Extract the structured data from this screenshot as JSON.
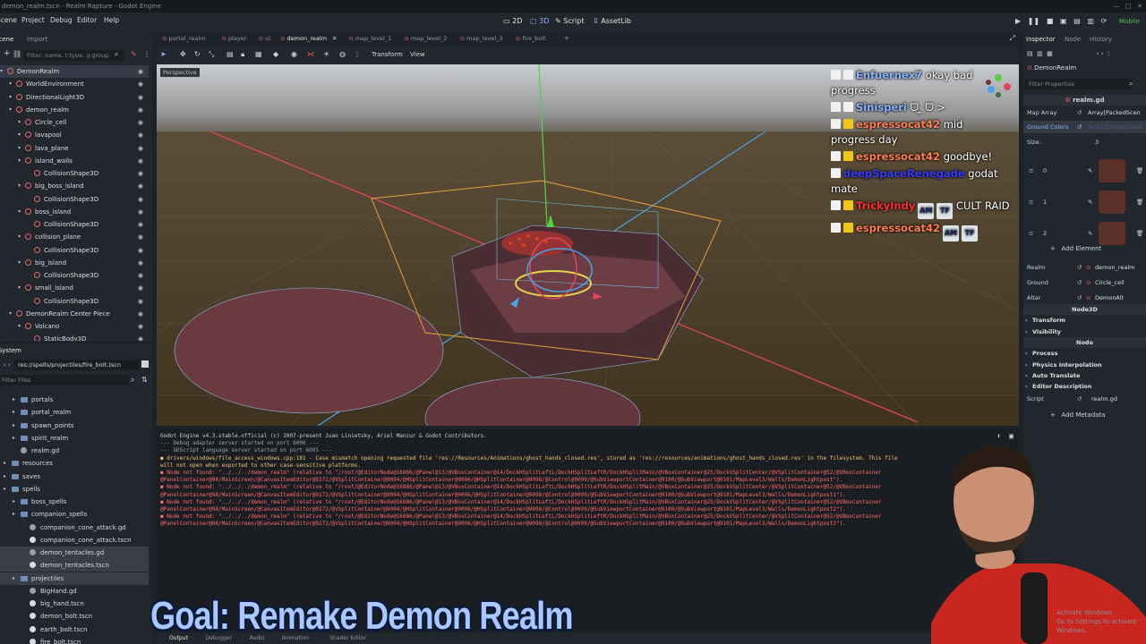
{
  "window": {
    "title": "demon_realm.tscn - Realm Rapture - Godot Engine",
    "controls": [
      "−",
      "□",
      "✕"
    ]
  },
  "menubar": {
    "menus": [
      "Scene",
      "Project",
      "Debug",
      "Editor",
      "Help"
    ],
    "workspaces": [
      {
        "label": "2D",
        "active": false
      },
      {
        "label": "3D",
        "active": true
      },
      {
        "label": "Script",
        "active": false
      },
      {
        "label": "AssetLib",
        "active": false
      }
    ],
    "renderer": "Mobile"
  },
  "scene_dock": {
    "tabs": [
      "Scene",
      "Import"
    ],
    "filter_placeholder": "Filter: name, t:type, g:group",
    "nodes": [
      {
        "label": "DemonRealm",
        "depth": 0,
        "icon": "node3d-icon",
        "selected": true
      },
      {
        "label": "WorldEnvironment",
        "depth": 1,
        "icon": "world-icon"
      },
      {
        "label": "DirectionalLight3D",
        "depth": 1,
        "icon": "light-icon"
      },
      {
        "label": "demon_realm",
        "depth": 1,
        "icon": "node3d-icon"
      },
      {
        "label": "Circle_cell",
        "depth": 2,
        "icon": "mesh-icon"
      },
      {
        "label": "lavapool",
        "depth": 2,
        "icon": "mesh-icon"
      },
      {
        "label": "lava_plane",
        "depth": 2,
        "icon": "mesh-icon"
      },
      {
        "label": "island_walls",
        "depth": 2,
        "icon": "mesh-icon"
      },
      {
        "label": "CollisionShape3D",
        "depth": 3,
        "icon": "collision-icon"
      },
      {
        "label": "big_boss_island",
        "depth": 2,
        "icon": "mesh-icon"
      },
      {
        "label": "CollisionShape3D",
        "depth": 3,
        "icon": "collision-icon"
      },
      {
        "label": "boss_island",
        "depth": 2,
        "icon": "mesh-icon"
      },
      {
        "label": "CollisionShape3D",
        "depth": 3,
        "icon": "collision-icon"
      },
      {
        "label": "collision_plane",
        "depth": 2,
        "icon": "mesh-icon"
      },
      {
        "label": "CollisionShape3D",
        "depth": 3,
        "icon": "collision-icon"
      },
      {
        "label": "big_island",
        "depth": 2,
        "icon": "mesh-icon"
      },
      {
        "label": "CollisionShape3D",
        "depth": 3,
        "icon": "collision-icon"
      },
      {
        "label": "small_island",
        "depth": 2,
        "icon": "mesh-icon"
      },
      {
        "label": "CollisionShape3D",
        "depth": 3,
        "icon": "collision-icon"
      },
      {
        "label": "DemonRealm Center Piece",
        "depth": 1,
        "icon": "node3d-icon"
      },
      {
        "label": "Volcano",
        "depth": 2,
        "icon": "mesh-icon"
      },
      {
        "label": "StaticBody3D",
        "depth": 3,
        "icon": "body-icon"
      }
    ]
  },
  "filesystem": {
    "tab": "FileSystem",
    "path": "res://spells/projectiles/fire_bolt.tscn",
    "filter_placeholder": "Filter Files",
    "items": [
      {
        "label": "portals",
        "depth": 1,
        "type": "folder"
      },
      {
        "label": "portal_realm",
        "depth": 1,
        "type": "folder"
      },
      {
        "label": "spawn_points",
        "depth": 1,
        "type": "folder"
      },
      {
        "label": "spirit_realm",
        "depth": 1,
        "type": "folder"
      },
      {
        "label": "realm.gd",
        "depth": 1,
        "type": "script"
      },
      {
        "label": "resources",
        "depth": 0,
        "type": "folder"
      },
      {
        "label": "saves",
        "depth": 0,
        "type": "folder"
      },
      {
        "label": "spells",
        "depth": 0,
        "type": "folder"
      },
      {
        "label": "boss_spells",
        "depth": 1,
        "type": "folder"
      },
      {
        "label": "companion_spells",
        "depth": 1,
        "type": "folder"
      },
      {
        "label": "companion_cone_attack.gd",
        "depth": 2,
        "type": "script"
      },
      {
        "label": "companion_cone_attack.tscn",
        "depth": 2,
        "type": "scene"
      },
      {
        "label": "demon_tentacles.gd",
        "depth": 2,
        "type": "script"
      },
      {
        "label": "demon_tentacles.tscn",
        "depth": 2,
        "type": "scene"
      },
      {
        "label": "projectiles",
        "depth": 1,
        "type": "folder"
      },
      {
        "label": "BigHand.gd",
        "depth": 2,
        "type": "script"
      },
      {
        "label": "big_hand.tscn",
        "depth": 2,
        "type": "scene"
      },
      {
        "label": "demon_bolt.tscn",
        "depth": 2,
        "type": "scene"
      },
      {
        "label": "earth_bolt.tscn",
        "depth": 2,
        "type": "scene"
      },
      {
        "label": "fire_bolt.tscn",
        "depth": 2,
        "type": "scene"
      }
    ]
  },
  "editor_tabs": [
    {
      "label": "portal_realm",
      "active": false
    },
    {
      "label": "player",
      "active": false
    },
    {
      "label": "ui",
      "active": false
    },
    {
      "label": "demon_realm",
      "active": true
    },
    {
      "label": "map_level_1",
      "active": false
    },
    {
      "label": "map_level_2",
      "active": false
    },
    {
      "label": "map_level_3",
      "active": false
    },
    {
      "label": "fire_bolt",
      "active": false
    }
  ],
  "viewport": {
    "toolbar_menus": [
      "Transform",
      "View"
    ],
    "perspective_label": "Perspective"
  },
  "chat": [
    {
      "name": "Enfuernex7",
      "name_color": "#8ab4ff",
      "message": "okay bad progress",
      "badge": "white"
    },
    {
      "name": "Sinisperi",
      "name_color": "#8ab4ff",
      "message": "ᗜ ̫ ᗜ >",
      "badge": "white"
    },
    {
      "name": "espressocat42",
      "name_color": "#ff7f50",
      "message": "mid progress day",
      "badge": "yellow"
    },
    {
      "name": "espressocat42",
      "name_color": "#ff7f50",
      "message": "goodbye!",
      "badge": "yellow"
    },
    {
      "name": "deepSpaceRenegade",
      "name_color": "#3a3aff",
      "message": "godat mate",
      "badge": ""
    },
    {
      "name": "TrickyIndy",
      "name_color": "#ff2d2d",
      "message": "CULT RAID",
      "badge": "yellow",
      "emotes": [
        "AM",
        "TF"
      ]
    },
    {
      "name": "espressocat42",
      "name_color": "#ff7f50",
      "message": "",
      "badge": "yellow",
      "emotes": [
        "AM",
        "TF"
      ]
    }
  ],
  "output": {
    "lines": [
      {
        "text": "Godot Engine v4.3.stable.official (c) 2007-present Juan Linietsky, Ariel Manzur & Godot Contributors.",
        "color": "#cfd3da"
      },
      {
        "text": "--- Debug adapter server started on port 6006 ---",
        "color": "#9aa0a8"
      },
      {
        "text": "--- GDScript language server started on port 6005 ---",
        "color": "#9aa0a8"
      },
      {
        "text": "● drivers/windows/file_access_windows.cpp:181 - Case mismatch opening requested file 'res://Resources/Animations/ghost_hands_closed.res', stored as 'res://resources/animations/ghost_hands_closed.res' in the filesystem. This file",
        "color": "#f0c674"
      },
      {
        "text": "will not open when exported to other case-sensitive platforms.",
        "color": "#f0c674"
      },
      {
        "text": "● Node not found: \"../../../demon_realm\" (relative to \"/root/@EditorNode@16886/@Panel@13/@VBoxContainer@14/DockHSplitLeftL/DockHSplitLeftR/DockHSplitMain/@VBoxContainer@25/DockVSplitCenter/@VSplitContainer@52/@VBoxContainer",
        "color": "#ff6b6b"
      },
      {
        "text": "@PanelContainer@98/MainScreen/@CanvasItemEditor@9272/@VSplitContainer@9094/@HSplitContainer@9096/@HSplitContainer@9098/@Control@9099/@SubViewportContainer@9100/@SubViewport@9101/MapLevel3/Walls/DemonLightpost\").",
        "color": "#ff6b6b"
      },
      {
        "text": "● Node not found: \"../../../demon_realm\" (relative to \"/root/@EditorNode@16886/@Panel@13/@VBoxContainer@14/DockHSplitLeftL/DockHSplitLeftR/DockHSplitMain/@VBoxContainer@25/DockVSplitCenter/@VSplitContainer@52/@VBoxContainer",
        "color": "#ff6b6b"
      },
      {
        "text": "@PanelContainer@98/MainScreen/@CanvasItemEditor@9272/@VSplitContainer@9094/@HSplitContainer@9096/@HSplitContainer@9098/@Control@9099/@SubViewportContainer@9100/@SubViewport@9101/MapLevel3/Walls/DemonLightpost1\").",
        "color": "#ff6b6b"
      },
      {
        "text": "● Node not found: \"../../../demon_realm\" (relative to \"/root/@EditorNode@16886/@Panel@13/@VBoxContainer@14/DockHSplitLeftL/DockHSplitLeftR/DockHSplitMain/@VBoxContainer@25/DockVSplitCenter/@VSplitContainer@52/@VBoxContainer",
        "color": "#ff6b6b"
      },
      {
        "text": "@PanelContainer@98/MainScreen/@CanvasItemEditor@9272/@VSplitContainer@9094/@HSplitContainer@9096/@HSplitContainer@9098/@Control@9099/@SubViewportContainer@9100/@SubViewport@9101/MapLevel3/Walls/DemonLightpost2\").",
        "color": "#ff6b6b"
      },
      {
        "text": "● Node not found: \"../../../demon_realm\" (relative to \"/root/@EditorNode@16886/@Panel@13/@VBoxContainer@14/DockHSplitLeftL/DockHSplitLeftR/DockHSplitMain/@VBoxContainer@25/DockVSplitCenter/@VSplitContainer@52/@VBoxContainer",
        "color": "#ff6b6b"
      },
      {
        "text": "@PanelContainer@98/MainScreen/@CanvasItemEditor@9272/@VSplitContainer@9094/@HSplitContainer@9096/@HSplitContainer@9098/@Control@9099/@SubViewportContainer@9100/@SubViewport@9101/MapLevel3/Walls/DemonLightpost2\").",
        "color": "#ff6b6b"
      }
    ]
  },
  "bottom_tabs": [
    "Output",
    "Debugger",
    "Audio",
    "Animation",
    "Shader Editor"
  ],
  "inspector": {
    "tabs": [
      "Inspector",
      "Node",
      "History"
    ],
    "node_name": "DemonRealm",
    "filter_placeholder": "Filter Properties",
    "script_header": "realm.gd",
    "map_array_label": "Map Array",
    "map_array_value": "Array[PackedScen",
    "ground_colors_label": "Ground Colors",
    "ground_colors_value": "Array[Compressed",
    "size_label": "Size:",
    "size_value": "3",
    "elements": [
      "0",
      "1",
      "2"
    ],
    "add_element": "Add Element",
    "props": [
      {
        "label": "Realm",
        "value": "demon_realm"
      },
      {
        "label": "Ground",
        "value": "Circle_cell"
      },
      {
        "label": "Altar",
        "value": "DemonAlt"
      }
    ],
    "sections": [
      "Node3D",
      "Transform",
      "Visibility",
      "Node",
      "Process",
      "Physics Interpolation",
      "Auto Translate",
      "Editor Description"
    ],
    "script_label": "Script",
    "script_value": "realm.gd",
    "add_metadata": "Add Metadata"
  },
  "overlay": {
    "caption": "Goal: Remake Demon Realm",
    "watermark_line1": "Activate Windows",
    "watermark_line2": "Go to Settings to activate Windows."
  },
  "colors": {
    "accent": "#8fb3f5",
    "panel": "#22262d",
    "viewport_ground": "#4a3a22",
    "caption": "#a9c8ff"
  }
}
